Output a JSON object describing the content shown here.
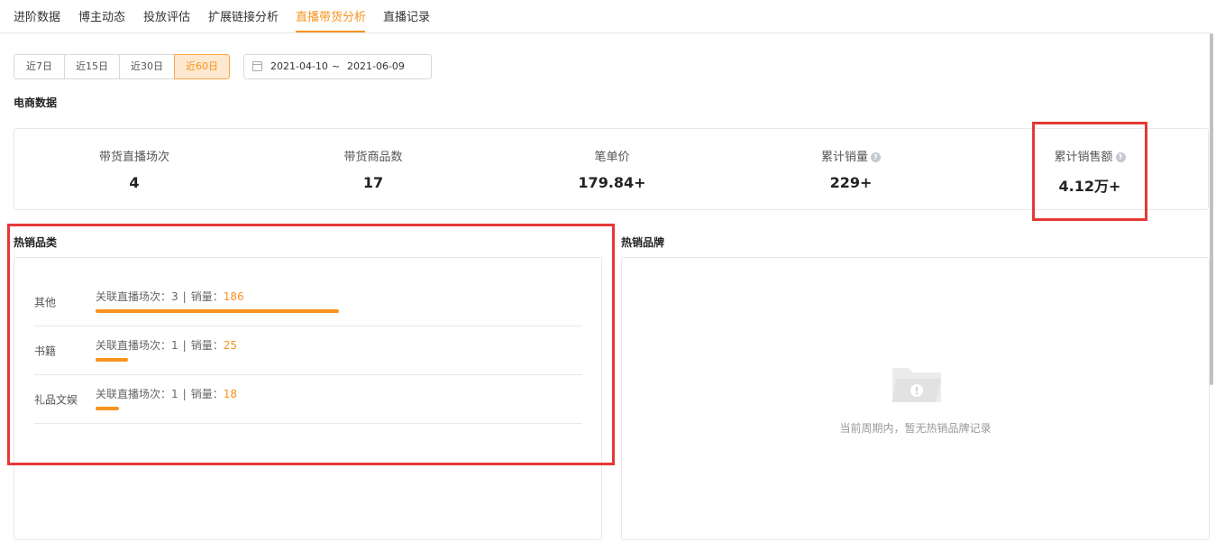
{
  "tabs": [
    {
      "label": "进阶数据"
    },
    {
      "label": "博主动态"
    },
    {
      "label": "投放评估"
    },
    {
      "label": "扩展链接分析"
    },
    {
      "label": "直播带货分析",
      "active": true
    },
    {
      "label": "直播记录"
    }
  ],
  "period": {
    "options": [
      "近7日",
      "近15日",
      "近30日",
      "近60日"
    ],
    "selected": "近60日",
    "date_start": "2021-04-10",
    "date_separator": "~",
    "date_end": "2021-06-09"
  },
  "ecommerce": {
    "title": "电商数据",
    "stats": [
      {
        "label": "带货直播场次",
        "value": "4"
      },
      {
        "label": "带货商品数",
        "value": "17"
      },
      {
        "label": "笔单价",
        "value": "179.84+"
      },
      {
        "label": "累计销量",
        "value": "229+",
        "help": "?"
      },
      {
        "label": "累计销售额",
        "value": "4.12万+",
        "help": "?"
      }
    ]
  },
  "hot_categories": {
    "title": "热销品类",
    "info_prefix": "关联直播场次：",
    "info_separator": "|",
    "sales_label": "销量：",
    "items": [
      {
        "name": "其他",
        "sessions": "3",
        "sales": "186",
        "bar_fraction": 1.0
      },
      {
        "name": "书籍",
        "sessions": "1",
        "sales": "25",
        "bar_fraction": 0.134
      },
      {
        "name": "礼品文娱",
        "sessions": "1",
        "sales": "18",
        "bar_fraction": 0.097
      }
    ]
  },
  "hot_brands": {
    "title": "热销品牌",
    "empty_text": "当前周期内，暂无热销品牌记录",
    "empty_icon": "empty-folder-icon"
  },
  "colors": {
    "accent": "#f7931e",
    "highlight": "#e53935",
    "border": "#e8e8e8"
  }
}
